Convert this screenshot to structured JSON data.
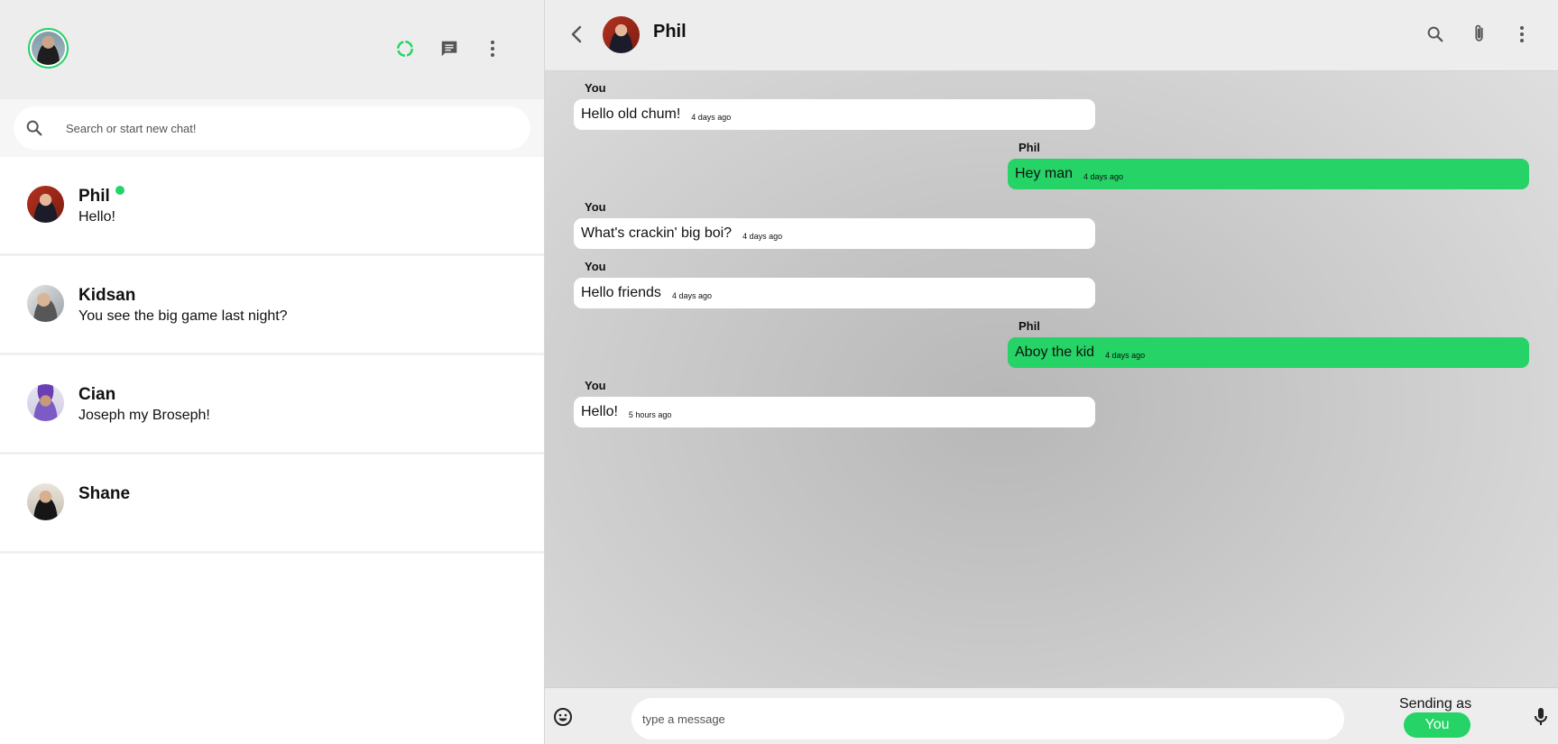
{
  "sidebar": {
    "search": {
      "placeholder": "Search or start new chat!"
    },
    "chats": [
      {
        "name": "Phil",
        "last_message": "Hello!",
        "online": true
      },
      {
        "name": "Kidsan",
        "last_message": "You see the big game last night?"
      },
      {
        "name": "Cian",
        "last_message": "Joseph my Broseph!"
      },
      {
        "name": "Shane",
        "last_message": ""
      }
    ]
  },
  "conversation": {
    "contact_name": "Phil",
    "messages": [
      {
        "sender": "You",
        "text": "Hello old chum!",
        "time": "4 days ago"
      },
      {
        "sender": "Phil",
        "text": "Hey man",
        "time": "4 days ago"
      },
      {
        "sender": "You",
        "text": "What's crackin' big boi?",
        "time": "4 days ago"
      },
      {
        "sender": "You",
        "text": "Hello friends",
        "time": "4 days ago"
      },
      {
        "sender": "Phil",
        "text": "Aboy the kid",
        "time": "4 days ago"
      },
      {
        "sender": "You",
        "text": "Hello!",
        "time": "5 hours ago"
      }
    ]
  },
  "composer": {
    "placeholder": "type a message",
    "sending_as_label": "Sending as",
    "sending_as_value": "You"
  },
  "icons": {
    "status": "status-icon",
    "new_chat": "new-chat-icon",
    "menu": "kebab-menu-icon",
    "search": "search-icon",
    "attach": "paperclip-icon",
    "back": "chevron-left-icon",
    "emoji": "emoji-icon",
    "mic": "microphone-icon"
  },
  "colors": {
    "accent": "#25d366",
    "header_bg": "#ededed",
    "icon_gray": "#555555"
  }
}
